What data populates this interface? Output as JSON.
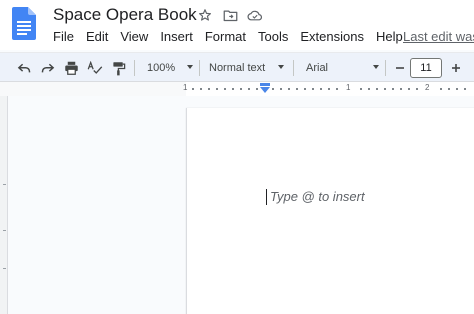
{
  "document": {
    "title": "Space Opera Book"
  },
  "menubar": {
    "items": [
      "File",
      "Edit",
      "View",
      "Insert",
      "Format",
      "Tools",
      "Extensions",
      "Help"
    ]
  },
  "status": {
    "last_edit": "Last edit was"
  },
  "toolbar": {
    "zoom": "100%",
    "style": "Normal text",
    "font": "Arial",
    "font_size": "11"
  },
  "ruler": {
    "labels": [
      "1",
      "1",
      "2"
    ]
  },
  "editor": {
    "placeholder": "Type @ to insert"
  },
  "colors": {
    "doc_blue": "#4285f4",
    "toolbar_bg": "#edf2fa",
    "indent_blue": "#4a86e8"
  }
}
